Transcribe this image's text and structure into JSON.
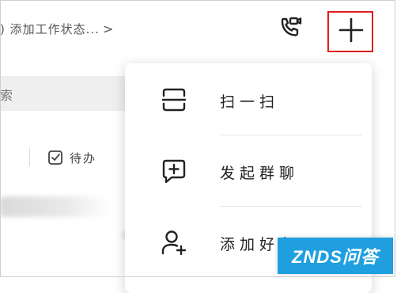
{
  "header": {
    "status_text": ") 添加工作状态...",
    "status_chevron": ">",
    "video_call_icon": "video-phone-icon",
    "plus_icon": "plus-icon",
    "highlight_color": "#e01c1c"
  },
  "background": {
    "search_text": "索",
    "todo_label": "待办",
    "todo_icon": "checkbox-icon"
  },
  "menu": {
    "items": [
      {
        "label": "扫一扫",
        "icon": "scan-icon"
      },
      {
        "label": "发起群聊",
        "icon": "group-chat-icon"
      },
      {
        "label": "添加好友",
        "icon": "add-friend-icon"
      }
    ]
  },
  "watermark": {
    "text": "ZNDS问答",
    "color": "#1f9fe0"
  }
}
